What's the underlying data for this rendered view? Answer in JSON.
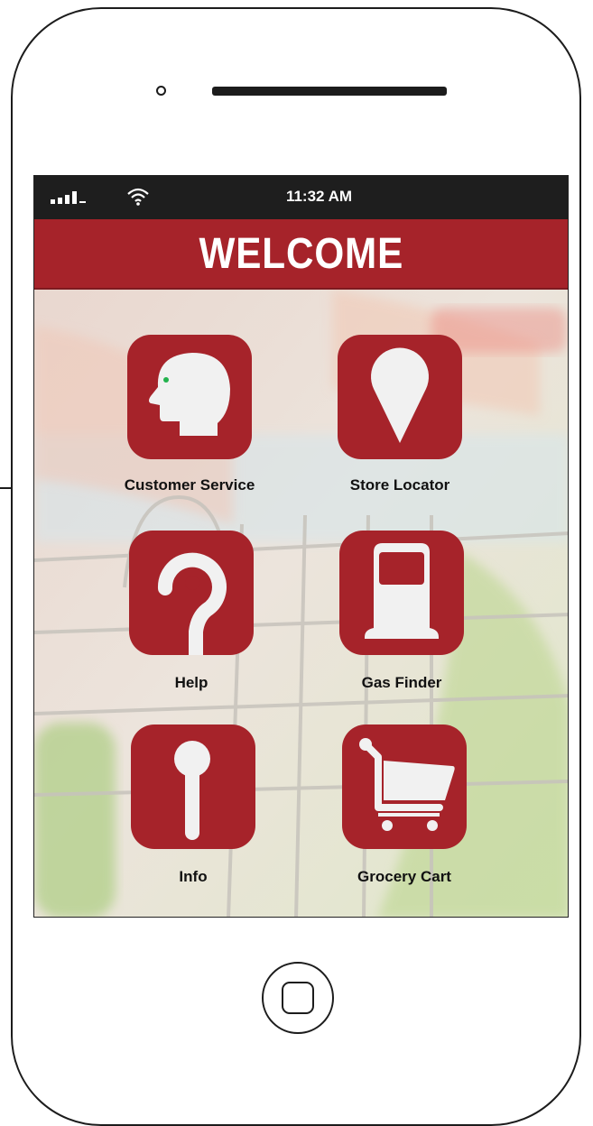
{
  "status_bar": {
    "time": "11:32 AM",
    "icons": [
      "signal-bars-icon",
      "wifi-icon"
    ]
  },
  "header": {
    "title": "WELCOME"
  },
  "menu": [
    {
      "id": "customer-service",
      "label": "Customer Service",
      "icon": "person-head-icon"
    },
    {
      "id": "store-locator",
      "label": "Store Locator",
      "icon": "map-pin-icon"
    },
    {
      "id": "help",
      "label": "Help",
      "icon": "question-mark-icon"
    },
    {
      "id": "gas-finder",
      "label": "Gas Finder",
      "icon": "gas-pump-icon"
    },
    {
      "id": "info",
      "label": "Info",
      "icon": "info-icon"
    },
    {
      "id": "grocery-cart",
      "label": "Grocery Cart",
      "icon": "shopping-cart-icon"
    }
  ],
  "colors": {
    "brand_red": "#a6232a",
    "status_bar": "#1e1e1e",
    "accent_green": "#22b24c"
  }
}
